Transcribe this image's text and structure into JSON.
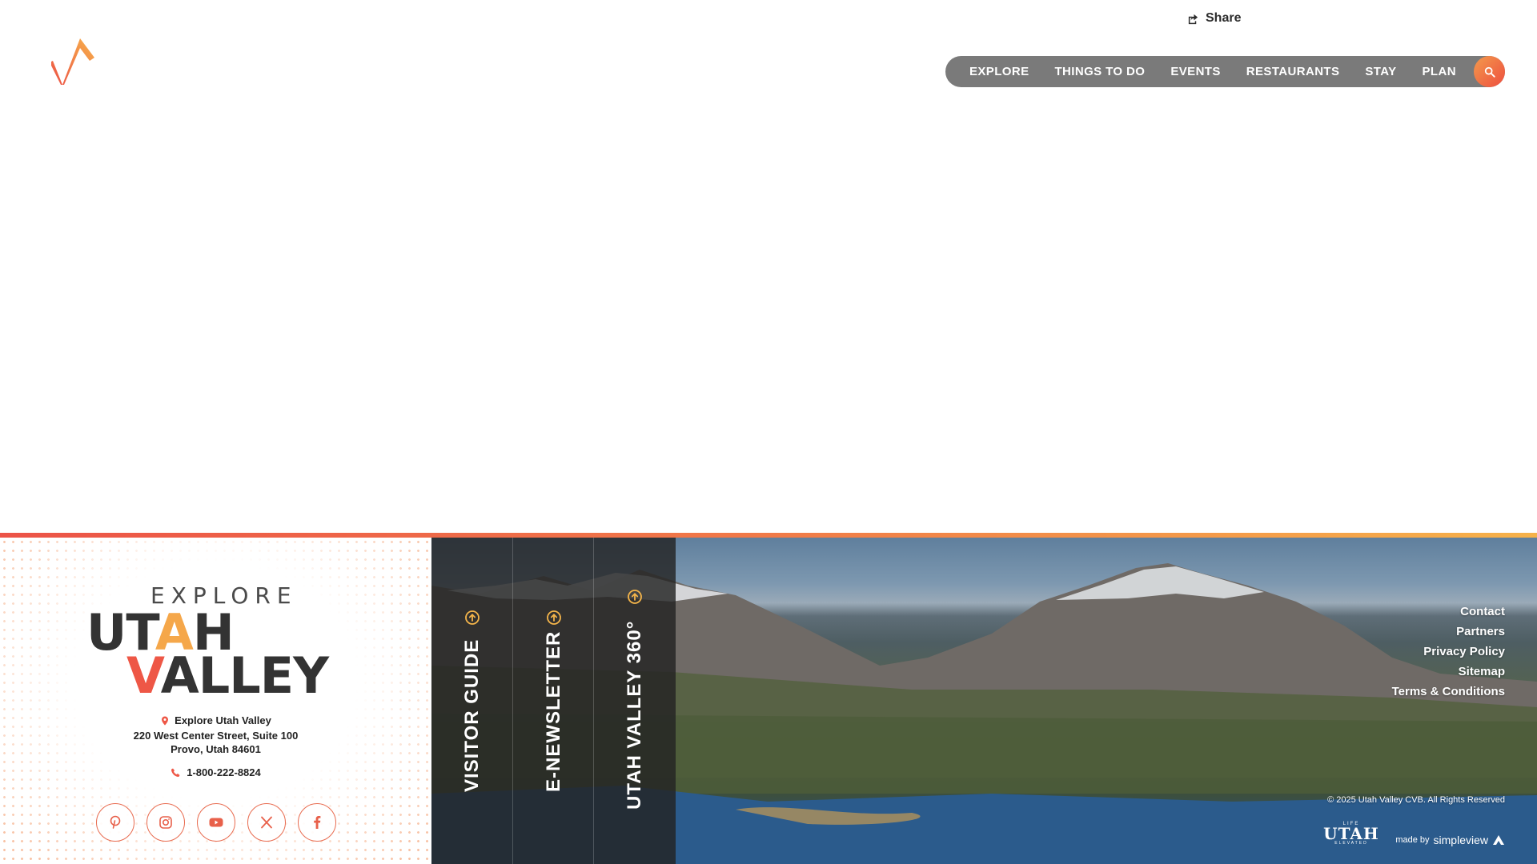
{
  "header": {
    "share_label": "Share",
    "nav": [
      "EXPLORE",
      "THINGS TO DO",
      "EVENTS",
      "RESTAURANTS",
      "STAY",
      "PLAN"
    ]
  },
  "colors": {
    "nav_bg": "#7a7a7a",
    "accent_red": "#ee5746",
    "accent_orange": "#f5a74a",
    "panel_bg": "#232323"
  },
  "footer": {
    "brand": {
      "explore": "EXPLORE",
      "utah_pre": "UT",
      "utah_a": "A",
      "utah_post": "H",
      "valley_v": "V",
      "valley_rest": "ALLEY"
    },
    "address": {
      "name": "Explore Utah Valley",
      "street": "220 West Center Street, Suite 100",
      "city": "Provo, Utah 84601"
    },
    "phone": "1-800-222-8824",
    "socials": [
      "pinterest-icon",
      "instagram-icon",
      "youtube-icon",
      "x-icon",
      "facebook-icon"
    ],
    "panels": [
      "VISITOR GUIDE",
      "E-NEWSLETTER",
      "UTAH VALLEY 360°"
    ],
    "links": [
      "Contact",
      "Partners",
      "Privacy Policy",
      "Sitemap",
      "Terms & Conditions"
    ],
    "copyright": "© 2025 Utah Valley CVB. All Rights Reserved",
    "life_logo": {
      "small": "LIFE",
      "big": "UTAH",
      "sub": "ELEVATED"
    },
    "made_by": {
      "prefix": "made by",
      "brand": "simpleview"
    }
  }
}
